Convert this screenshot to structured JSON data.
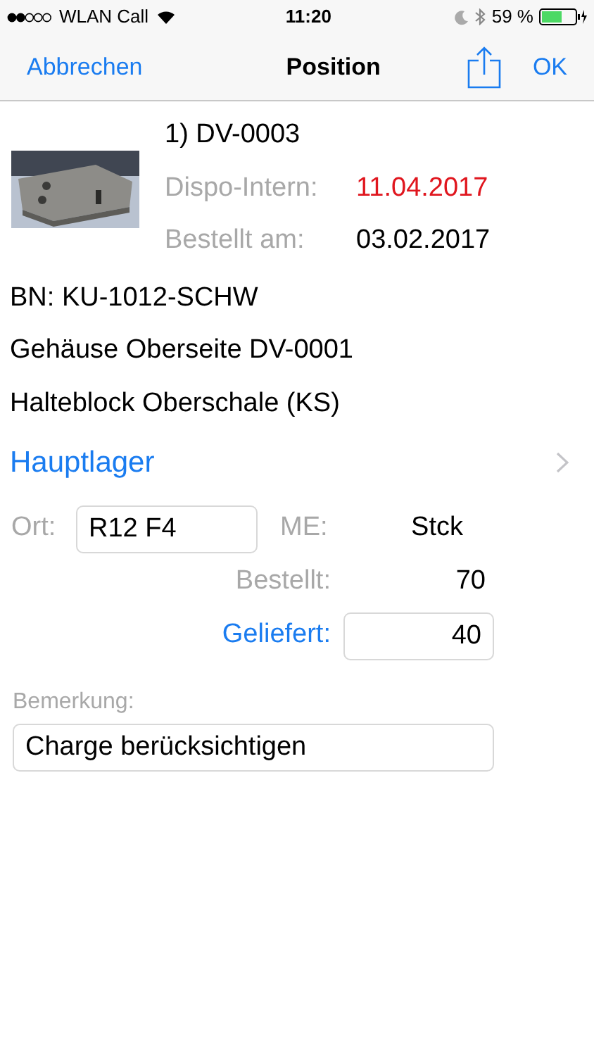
{
  "status_bar": {
    "carrier": "WLAN Call",
    "time": "11:20",
    "battery": "59 %"
  },
  "nav": {
    "cancel": "Abbrechen",
    "title": "Position",
    "ok": "OK"
  },
  "item": {
    "title": "1) DV-0003",
    "dispo_label": "Dispo-Intern:",
    "dispo_value": "11.04.2017",
    "dispo_overdue": true,
    "ordered_label": "Bestellt am:",
    "ordered_value": "03.02.2017"
  },
  "lines": [
    "BN: KU-1012-SCHW",
    "Gehäuse Oberseite DV-0001",
    "Halteblock Oberschale (KS)"
  ],
  "warehouse": "Hauptlager",
  "location": {
    "label": "Ort:",
    "value": "R12 F4"
  },
  "unit": {
    "label": "ME:",
    "value": "Stck"
  },
  "ordered": {
    "label": "Bestellt:",
    "value": "70"
  },
  "delivered": {
    "label": "Geliefert:",
    "value": "40"
  },
  "remark": {
    "label": "Bemerkung:",
    "value": "Charge berücksichtigen"
  }
}
